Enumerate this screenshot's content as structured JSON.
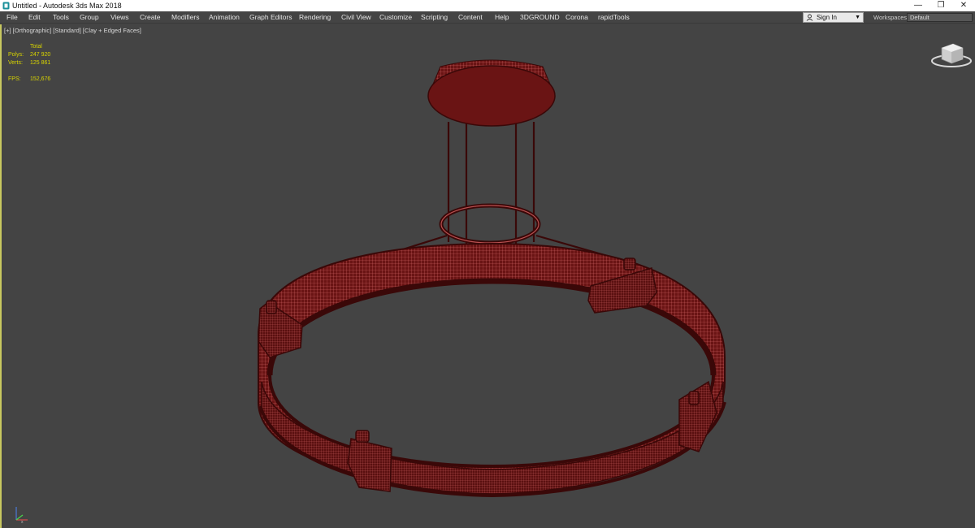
{
  "window": {
    "title": "Untitled - Autodesk 3ds Max 2018",
    "minimize_glyph": "—",
    "maximize_glyph": "❐",
    "close_glyph": "✕"
  },
  "menu": {
    "items": [
      "File",
      "Edit",
      "Tools",
      "Group",
      "Views",
      "Create",
      "Modifiers",
      "Animation",
      "Graph Editors",
      "Rendering",
      "Civil View",
      "Customize",
      "Scripting",
      "Content",
      "Help",
      "3DGROUND",
      "Corona",
      "rapidTools"
    ],
    "sign_in": "Sign In",
    "workspaces_label": "Workspaces:",
    "workspace_value": "Default"
  },
  "viewport": {
    "label": "[+] [Orthographic] [Standard] [Clay + Edged Faces]",
    "stats": {
      "header": "Total",
      "polys_label": "Polys:",
      "polys_value": "247 920",
      "verts_label": "Verts:",
      "verts_value": "125 861",
      "fps_label": "FPS:",
      "fps_value": "152,676"
    }
  },
  "colors": {
    "background": "#444444",
    "mesh_fill": "#6a1414",
    "mesh_wire": "#d06565",
    "mesh_dark": "#3a0808",
    "stats_text": "#d8d400",
    "viewport_border": "#c8c860"
  },
  "icons": [
    "app-icon",
    "user-icon",
    "chevron-down-icon",
    "viewcube-icon",
    "axis-tripod-icon"
  ]
}
